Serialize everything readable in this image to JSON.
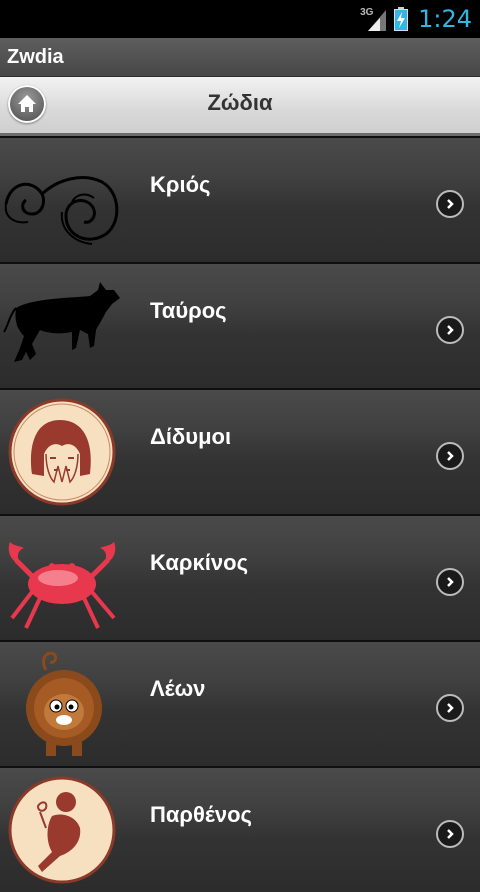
{
  "status_bar": {
    "network": "3G",
    "time": "1:24",
    "icons": [
      "signal-icon",
      "battery-charging-icon"
    ]
  },
  "app_title": "Zwdia",
  "header": {
    "title": "Ζώδια",
    "home_icon": "home-icon"
  },
  "signs": [
    {
      "label": "Κριός",
      "icon": "aries-ram-horns-icon"
    },
    {
      "label": "Ταύρος",
      "icon": "taurus-bull-icon"
    },
    {
      "label": "Δίδυμοι",
      "icon": "gemini-twins-icon"
    },
    {
      "label": "Καρκίνος",
      "icon": "cancer-crab-icon"
    },
    {
      "label": "Λέων",
      "icon": "leo-lion-icon"
    },
    {
      "label": "Παρθένος",
      "icon": "virgo-maiden-icon"
    }
  ],
  "colors": {
    "clock": "#33b5e5",
    "crab": "#e8384d",
    "medallion": "#f6e0c0"
  }
}
